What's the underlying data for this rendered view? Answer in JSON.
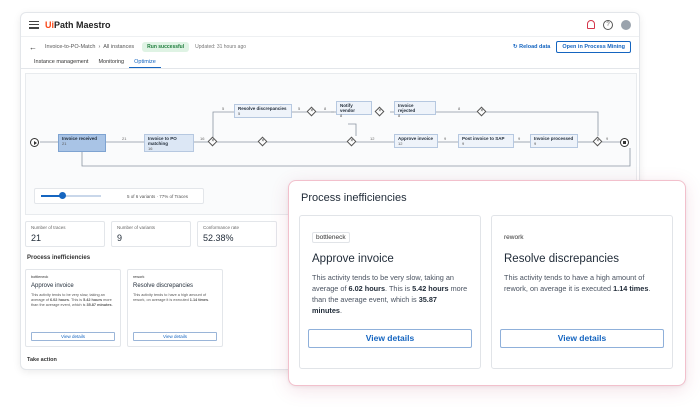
{
  "app": {
    "logo_prefix": "Ui",
    "logo_rest": "Path Maestro",
    "help_icon": "help-icon",
    "notification_icon": "bell-icon"
  },
  "crumbs": {
    "back_icon": "←",
    "path1": "Invoice-to-PO-Match",
    "sep": "›",
    "path2": "All instances",
    "status": "Run successful",
    "updated": "Updated: 31 hours ago",
    "reload": "Reload data",
    "open": "Open in Process Mining"
  },
  "tabs": [
    {
      "label": "Instance management"
    },
    {
      "label": "Monitoring"
    },
    {
      "label": "Optimize"
    }
  ],
  "flow": {
    "nodes": {
      "invoice_received": {
        "label": "Invoice received",
        "count": "21"
      },
      "invoice_to_po": {
        "label": "Invoice to PO matching",
        "count": "16"
      },
      "resolve": {
        "label": "Resolve discrepancies",
        "count": "5"
      },
      "notify": {
        "label": "Notify vendor",
        "count": "8"
      },
      "rejected": {
        "label": "Invoice rejected",
        "count": "8"
      },
      "approve": {
        "label": "Approve invoice",
        "count": "12"
      },
      "post_sap": {
        "label": "Post invoice to SAP",
        "count": "9"
      },
      "processed": {
        "label": "Invoice processed",
        "count": "9"
      }
    },
    "edge_labels": [
      "21",
      "16",
      "5",
      "5",
      "8",
      "8",
      "12",
      "9",
      "9",
      "9"
    ]
  },
  "slider": {
    "text": "5 of 6 variants  ·  77% of Traces",
    "value_fraction": 0.35
  },
  "metrics": [
    {
      "label": "Number of traces",
      "value": "21"
    },
    {
      "label": "Number of variants",
      "value": "9"
    },
    {
      "label": "Conformance rate",
      "value": "52.38%"
    }
  ],
  "small_section": {
    "title": "Process inefficiencies",
    "take_action": "Take action"
  },
  "inefficiencies": {
    "title": "Process inefficiencies",
    "cards": [
      {
        "tag": "bottleneck",
        "title": "Approve invoice",
        "body_1": "This activity tends to be very slow, taking an average of ",
        "b1": "6.02 hours",
        "body_2": ". This is ",
        "b2": "5.42 hours",
        "body_3": " more than the average event, which is ",
        "b3": "35.87 minutes",
        "body_4": ".",
        "button": "View details"
      },
      {
        "tag": "rework",
        "title": "Resolve discrepancies",
        "body_1": "This activity tends to have a high amount of rework, on average it is executed ",
        "b1": "1.14 times",
        "body_2": ".",
        "button": "View details"
      }
    ]
  }
}
